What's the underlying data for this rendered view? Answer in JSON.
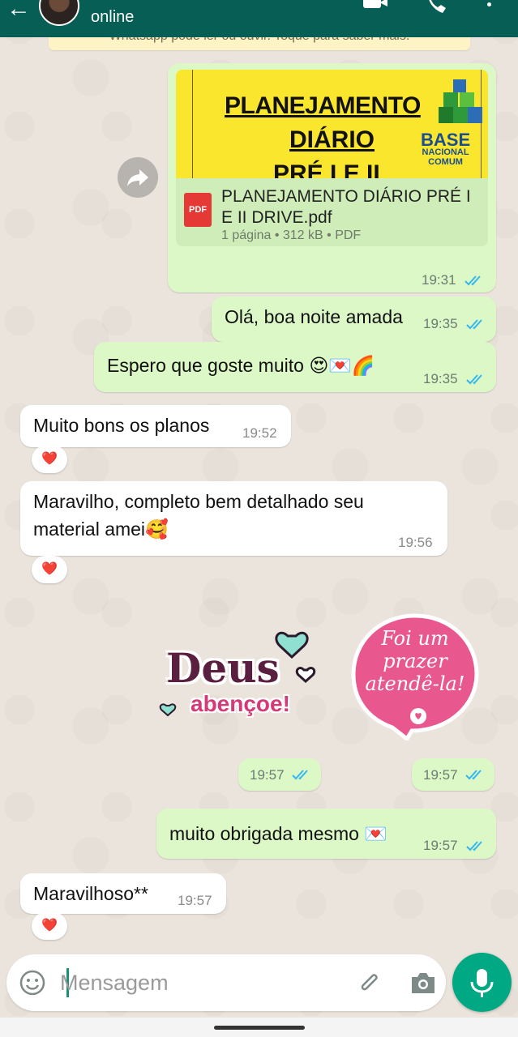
{
  "header": {
    "status": "online"
  },
  "encryption_banner": "Whatsapp pode ler ou ouvir. Toque para saber mais.",
  "messages": {
    "doc": {
      "preview_line1": "PLANEJAMENTO",
      "preview_line2": "DIÁRIO",
      "preview_line3": "PRÉ I E II",
      "preview_brand1": "BASE",
      "preview_brand2": "NACIONAL",
      "preview_brand3": "COMUM",
      "icon_label": "PDF",
      "file_name": "PLANEJAMENTO DIÁRIO PRÉ I E II DRIVE.pdf",
      "meta": "1 página • 312 kB • PDF",
      "time": "19:31"
    },
    "m1": {
      "text": "Olá, boa noite amada",
      "time": "19:35"
    },
    "m2": {
      "text": "Espero que goste muito 😍💌🌈",
      "time": "19:35"
    },
    "m3": {
      "text": "Muito bons os planos",
      "time": "19:52",
      "reaction": "❤️"
    },
    "m4": {
      "text_line1": "Maravilho, completo bem detalhado seu",
      "text_line2": "material amei🥰",
      "time": "19:56",
      "reaction": "❤️"
    },
    "sticker1": {
      "line1": "Deus",
      "line2": "abençoe!",
      "time": "19:57"
    },
    "sticker2": {
      "line1": "Foi um",
      "line2": "prazer",
      "line3": "atendê-la!",
      "time": "19:57"
    },
    "m5": {
      "text": "muito obrigada mesmo 💌",
      "time": "19:57"
    },
    "m6": {
      "text": "Maravilhoso**",
      "time": "19:57",
      "reaction": "❤️"
    }
  },
  "composer": {
    "placeholder": "Mensagem"
  },
  "colors": {
    "header": "#075e54",
    "outgoing_bubble": "#dcf8c6",
    "incoming_bubble": "#ffffff",
    "read_ticks": "#34b7f1",
    "mic_button": "#00a884"
  },
  "icons": [
    "back-arrow-icon",
    "video-call-icon",
    "phone-icon",
    "menu-icon",
    "forward-icon",
    "pdf-icon",
    "double-check-icon",
    "emoji-icon",
    "attach-icon",
    "camera-icon",
    "mic-icon"
  ]
}
